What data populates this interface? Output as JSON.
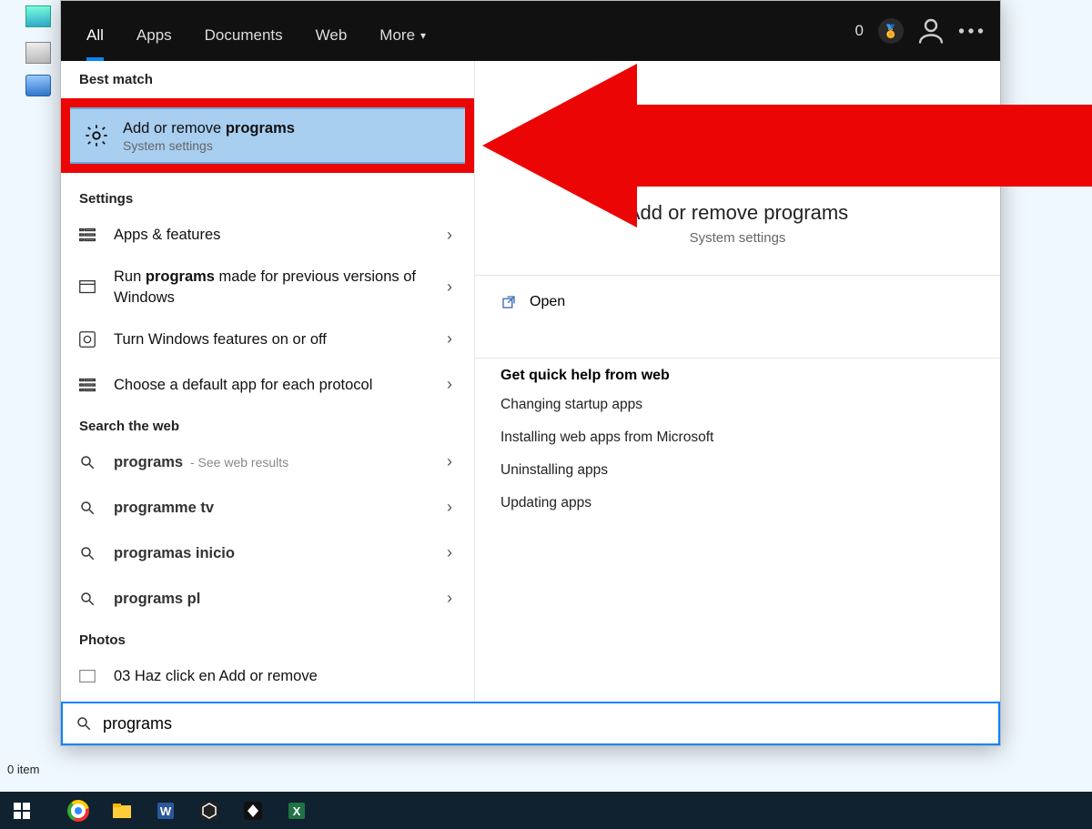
{
  "desktop": {
    "items_text": "0 item"
  },
  "header": {
    "tabs": [
      "All",
      "Apps",
      "Documents",
      "Web",
      "More"
    ],
    "count": "0"
  },
  "sections": {
    "best_match": "Best match",
    "settings": "Settings",
    "search_web": "Search the web",
    "photos": "Photos"
  },
  "best": {
    "title_pre": "Add or remove ",
    "title_bold": "programs",
    "subtitle": "System settings"
  },
  "settings_items": [
    {
      "title": "Apps & features"
    },
    {
      "title_pre": "Run ",
      "title_bold": "programs",
      "title_post": " made for previous versions of Windows"
    },
    {
      "title": "Turn Windows features on or off"
    },
    {
      "title": "Choose a default app for each protocol"
    }
  ],
  "web_items": [
    {
      "bold": "programs",
      "hint": " - See web results"
    },
    {
      "bold": "programme tv"
    },
    {
      "bold": "programas inicio"
    },
    {
      "bold": "programs pl"
    }
  ],
  "photos_items": [
    {
      "title": "03 Haz click en Add or remove"
    }
  ],
  "preview": {
    "title": "Add or remove programs",
    "subtitle": "System settings",
    "open": "Open",
    "quick_title": "Get quick help from web",
    "quick": [
      "Changing startup apps",
      "Installing web apps from Microsoft",
      "Uninstalling apps",
      "Updating apps"
    ]
  },
  "search": {
    "value": "programs"
  }
}
